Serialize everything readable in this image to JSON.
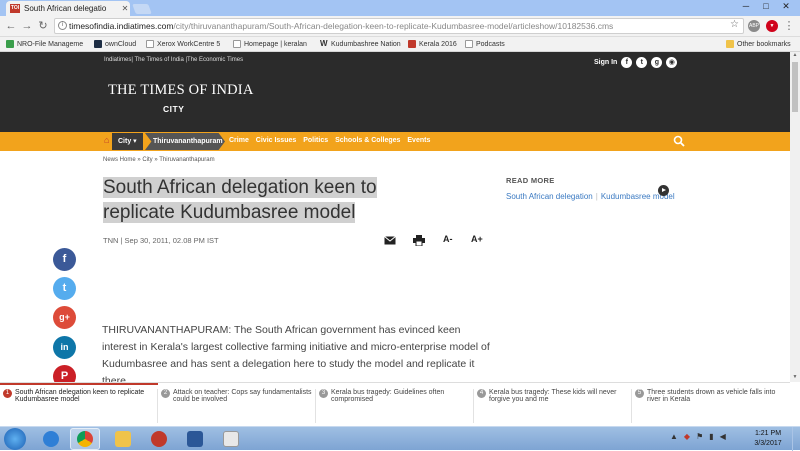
{
  "browser": {
    "tab_title": "South African delegatio",
    "tab_favicon": "TOI",
    "url_host": "timesofindia.indiatimes.com",
    "url_path": "/city/thiruvananthapuram/South-African-delegation-keen-to-replicate-Kudumbasree-model/articleshow/10182536.cms",
    "bookmarks": [
      "NRO-File Manageme",
      "ownCloud",
      "Xerox WorkCentre 5",
      "Homepage | keralan",
      "Kudumbashree Nation",
      "Kerala 2016",
      "Podcasts"
    ],
    "other_bookmarks": "Other bookmarks"
  },
  "site": {
    "top_links": "Indiatimes| The Times of India |The Economic Times",
    "sign_in": "Sign In",
    "logo": "THE TIMES OF INDIA",
    "section": "CITY"
  },
  "nav": {
    "city": "City",
    "subcity": "Thiruvananthapuram",
    "links": [
      "Crime",
      "Civic Issues",
      "Politics",
      "Schools & Colleges",
      "Events"
    ]
  },
  "article": {
    "breadcrumb": "News Home » City » Thiruvananthapuram",
    "headline_line1": "South African delegation keen to",
    "headline_line2": "replicate Kudumbasree model",
    "byline": "TNN | Sep 30, 2011, 02.08 PM IST",
    "font_smaller": "A-",
    "font_larger": "A+",
    "body": "THIRUVANANTHAPURAM: The South African government has evinced keen interest in Kerala's largest collective farming initiative and micro-enterprise model of Kudumbasree and has sent a delegation here to study the model and replicate it there."
  },
  "read_more": {
    "title": "READ MORE",
    "link1": "South African delegation",
    "link2": "Kudumbasree model"
  },
  "share": [
    "f",
    "t",
    "g+",
    "in",
    "P"
  ],
  "strip": [
    {
      "num": "1",
      "text": "South African delegation keen to replicate Kudumbasree model"
    },
    {
      "num": "2",
      "text": "Attack on teacher: Cops say fundamentalists could be involved"
    },
    {
      "num": "3",
      "text": "Kerala bus tragedy: Guidelines often compromised"
    },
    {
      "num": "4",
      "text": "Kerala bus tragedy: These kids will never forgive you and me"
    },
    {
      "num": "5",
      "text": "Three students drown as vehicle falls into river in Kerala"
    }
  ],
  "taskbar": {
    "time": "1:21 PM",
    "date": "3/3/2017"
  },
  "colors": {
    "masthead": "#2b2b2b",
    "navbar": "#f2a31c",
    "link": "#3b7ac2",
    "accent": "#c0392b"
  }
}
